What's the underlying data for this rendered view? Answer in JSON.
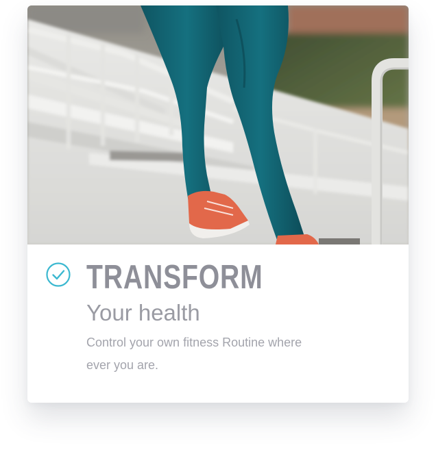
{
  "feature_card": {
    "image_alt": "Runner climbing stadium stairs",
    "heading": "TRANSFORM",
    "subheading": "Your health",
    "description": "Control your own fitness Routine where ever you are.",
    "check_icon": "check-circle-icon",
    "accent_color": "#3bb8d0",
    "heading_color": "#8e8f98"
  }
}
